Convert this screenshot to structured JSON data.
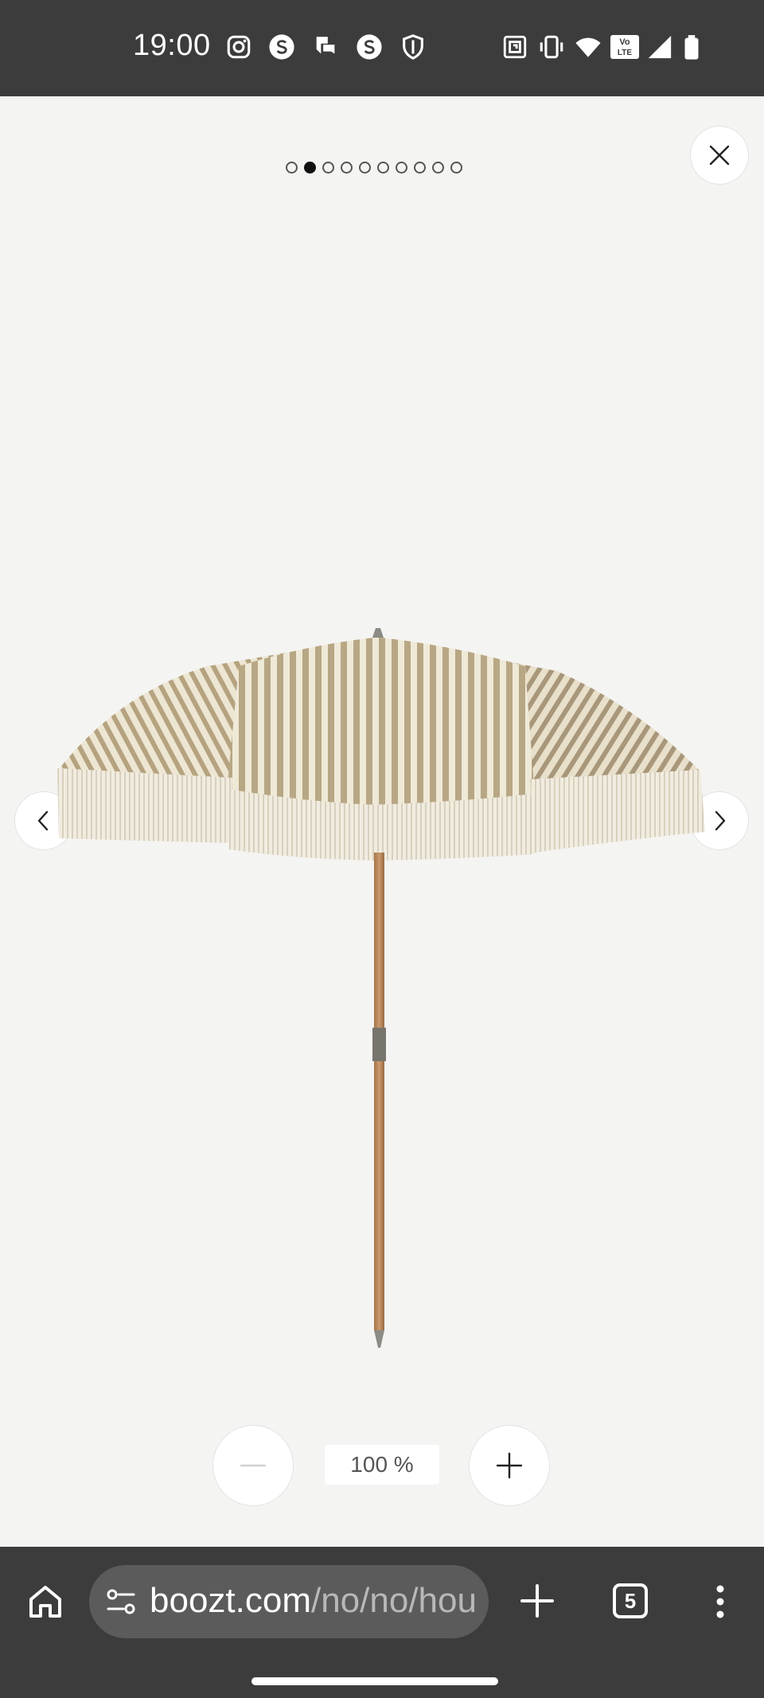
{
  "status_bar": {
    "time": "19:00",
    "notification_icons": [
      "instagram-icon",
      "s-app-icon",
      "chat-icon",
      "s-app-icon",
      "shield-icon"
    ],
    "system_icons": [
      "nfc-icon",
      "vibrate-icon",
      "wifi-icon",
      "volte-icon",
      "signal-icon",
      "battery-icon"
    ],
    "volte_label": "Vo LTE"
  },
  "viewer": {
    "pagination": {
      "total": 10,
      "current": 2
    },
    "zoom_level": "100 %",
    "image_alt": "Striped beach umbrella with fringe"
  },
  "browser": {
    "url_domain": "boozt.com",
    "url_path": "/no/no/hou",
    "tab_count": "5"
  },
  "colors": {
    "system_bar": "#3c3c3c",
    "viewer_bg": "#f4f4f2",
    "url_field": "#5b5b5b"
  }
}
